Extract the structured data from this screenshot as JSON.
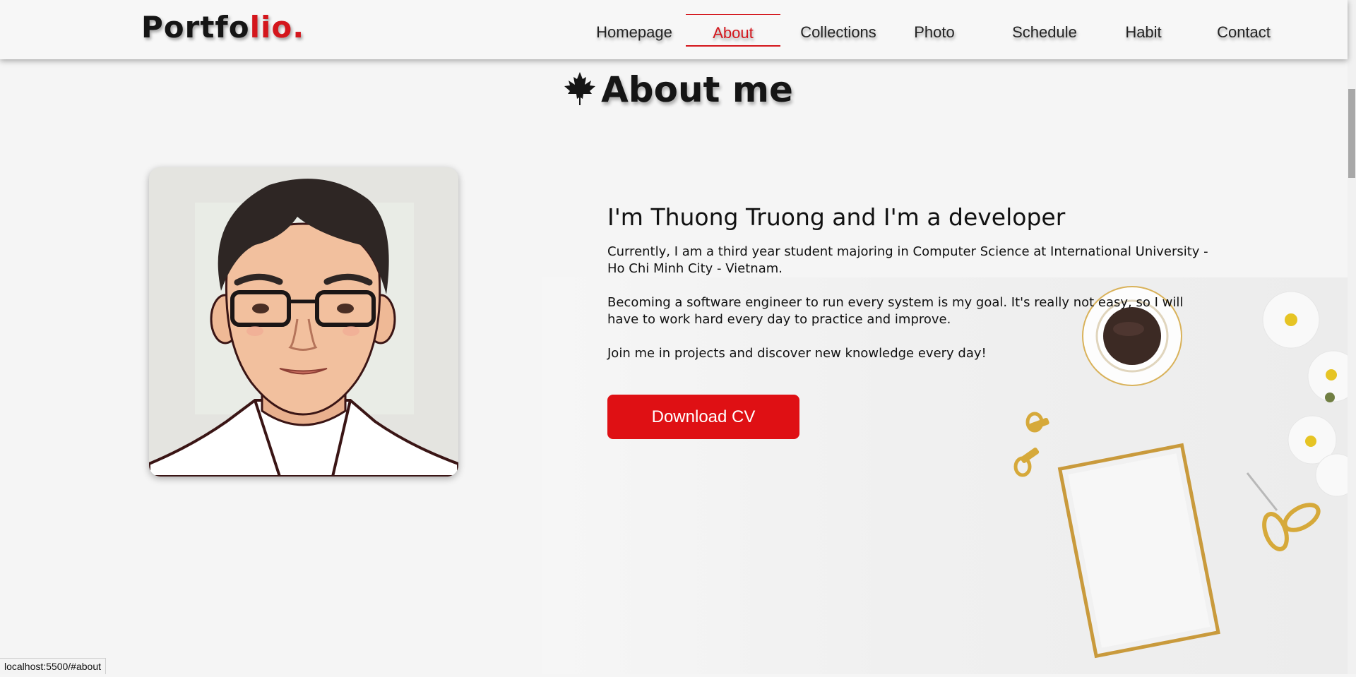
{
  "header": {
    "logo_main": "Portfo",
    "logo_accent": "lio.",
    "nav": [
      {
        "label": "Homepage"
      },
      {
        "label": "About"
      },
      {
        "label": "Collections"
      },
      {
        "label": "Photo"
      },
      {
        "label": "Schedule"
      },
      {
        "label": "Habit"
      },
      {
        "label": "Contact"
      }
    ],
    "active_nav": "About"
  },
  "about": {
    "section_title": "About me",
    "title_icon": "maple-leaf-icon",
    "heading": "I'm Thuong Truong and I'm a developer",
    "paragraphs": [
      "Currently, I am a third year student majoring in Computer Science at International University - Ho Chi Minh City - Vietnam.",
      "Becoming a software engineer to run every system is my goal. It's really not easy, so I will have to work hard every day to practice and improve.",
      "Join me in projects and discover new knowledge every day!"
    ],
    "cv_button": "Download CV"
  },
  "status_bar": {
    "url": "localhost:5500/#about"
  },
  "colors": {
    "accent": "#d4161c",
    "button": "#df1014",
    "background": "#f5f5f5"
  }
}
